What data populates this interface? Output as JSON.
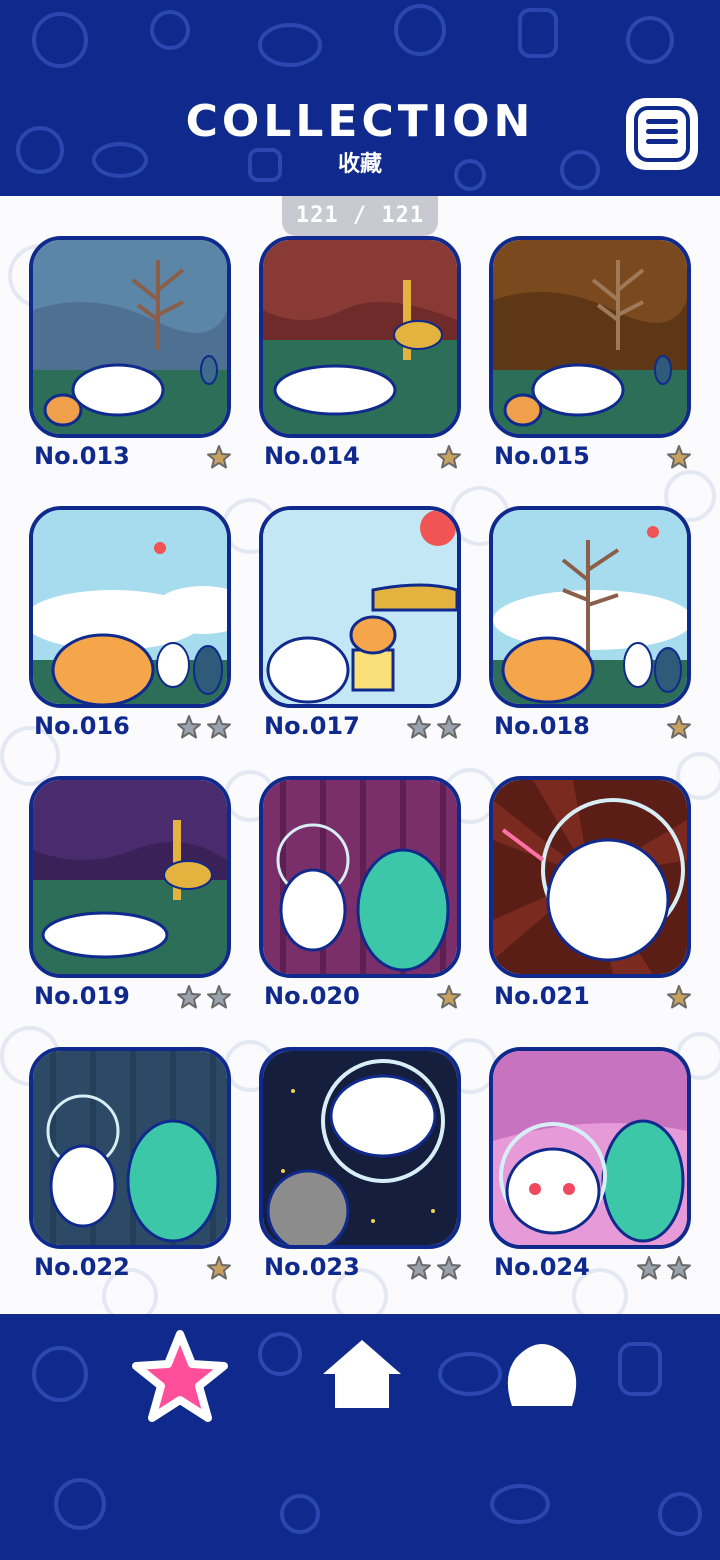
{
  "header": {
    "title": "COLLECTION",
    "subtitle": "收藏"
  },
  "counter": "121 / 121",
  "colors": {
    "navy": "#0f2a8c",
    "pink": "#ff4f9a",
    "gold": "#c9a15e",
    "gray": "#9aa3ad"
  },
  "items": [
    {
      "label": "No.013",
      "stars": 1
    },
    {
      "label": "No.014",
      "stars": 1
    },
    {
      "label": "No.015",
      "stars": 1
    },
    {
      "label": "No.016",
      "stars": 2
    },
    {
      "label": "No.017",
      "stars": 2
    },
    {
      "label": "No.018",
      "stars": 1
    },
    {
      "label": "No.019",
      "stars": 2
    },
    {
      "label": "No.020",
      "stars": 1
    },
    {
      "label": "No.021",
      "stars": 1
    },
    {
      "label": "No.022",
      "stars": 1
    },
    {
      "label": "No.023",
      "stars": 2
    },
    {
      "label": "No.024",
      "stars": 2
    }
  ],
  "nav": {
    "left": "star-icon",
    "middle": "home-icon",
    "right": "dog-icon"
  }
}
